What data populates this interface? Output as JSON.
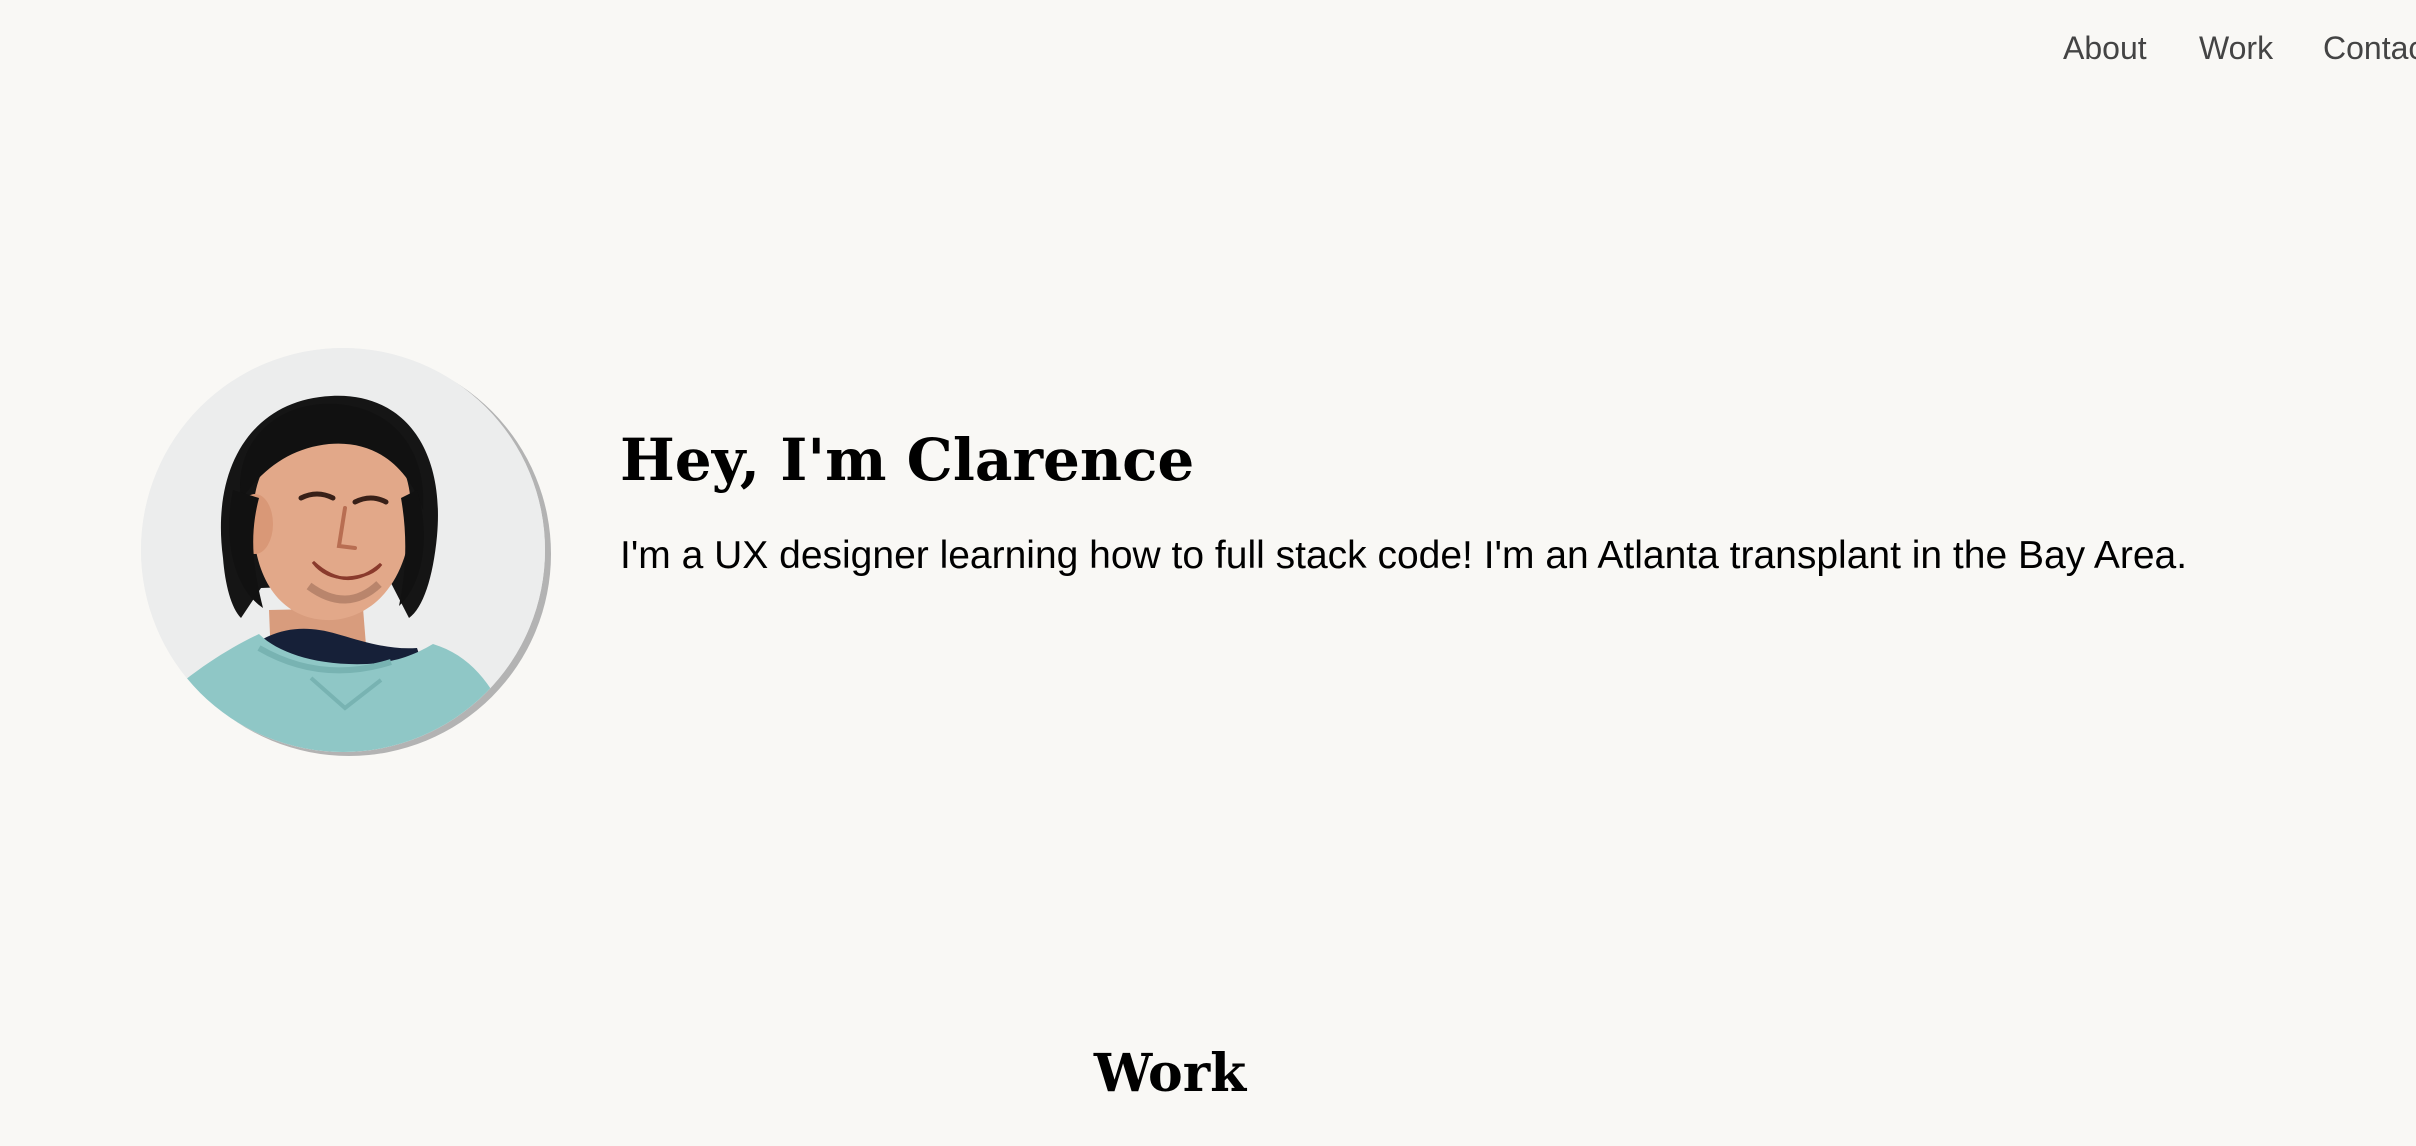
{
  "nav": {
    "items": [
      {
        "label": "About"
      },
      {
        "label": "Work"
      },
      {
        "label": "Contact"
      }
    ]
  },
  "hero": {
    "title": "Hey, I'm Clarence",
    "description": "I'm a UX designer learning how to full stack code! I'm an Atlanta transplant in the Bay Area."
  },
  "sections": {
    "work_title": "Work"
  },
  "colors": {
    "background": "#f9f8f5",
    "nav_text": "#444444",
    "heading_text": "#000000",
    "avatar_shadow": "#b3b3b3",
    "shirt": "#8fc7c6"
  }
}
